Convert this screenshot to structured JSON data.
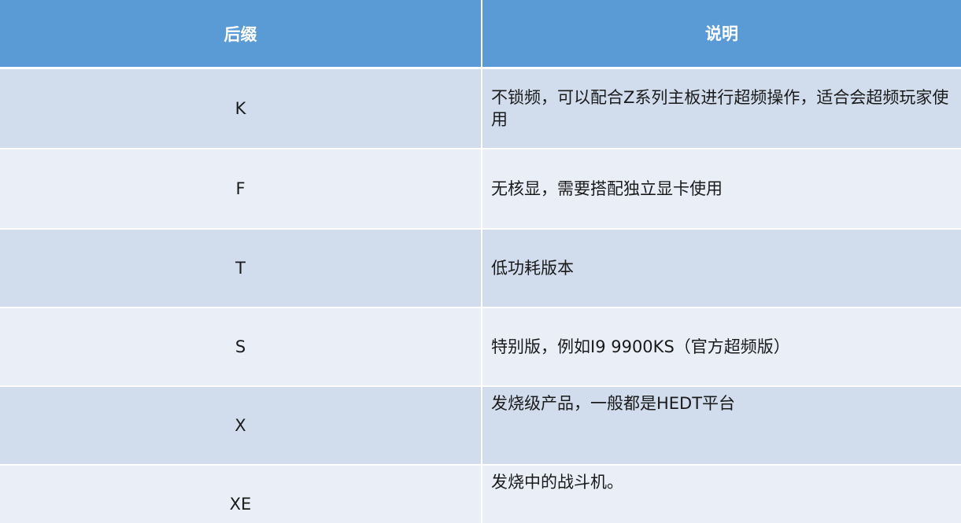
{
  "table": {
    "headers": [
      "后缀",
      "说明"
    ],
    "rows": [
      {
        "suffix": "K",
        "desc": "不锁频，可以配合Z系列主板进行超频操作，适合会超频玩家使用"
      },
      {
        "suffix": "F",
        "desc": "无核显，需要搭配独立显卡使用"
      },
      {
        "suffix": "T",
        "desc": "低功耗版本"
      },
      {
        "suffix": "S",
        "desc": "特别版，例如I9 9900KS（官方超频版）"
      },
      {
        "suffix": "X",
        "desc": "发烧级产品，一般都是HEDT平台"
      },
      {
        "suffix": "XE",
        "desc": "发烧中的战斗机。"
      }
    ]
  }
}
